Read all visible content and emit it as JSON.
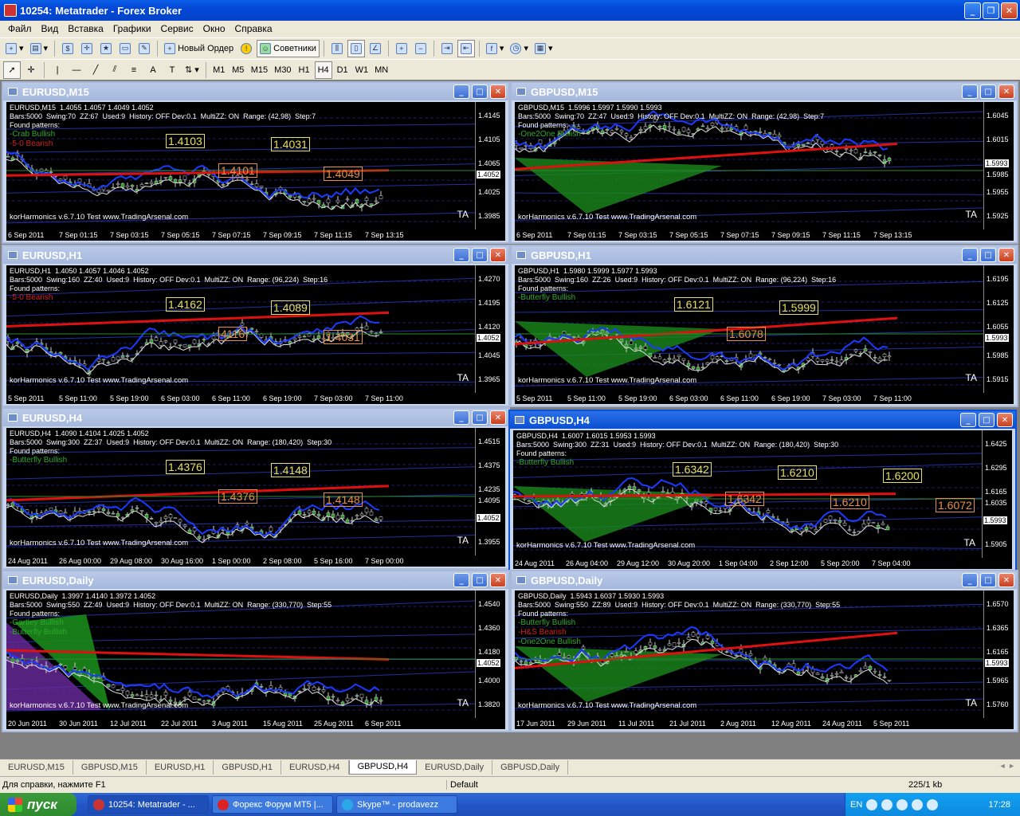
{
  "window": {
    "title": "10254: Metatrader - Forex Broker"
  },
  "menu": [
    "Файл",
    "Вид",
    "Вставка",
    "Графики",
    "Сервис",
    "Окно",
    "Справка"
  ],
  "toolbar": {
    "new_order": "Новый Ордер",
    "experts": "Советники"
  },
  "timeframes": [
    "M1",
    "M5",
    "M15",
    "M30",
    "H1",
    "H4",
    "D1",
    "W1",
    "MN"
  ],
  "active_timeframe": "H4",
  "charts": [
    {
      "id": "eurusd-m15",
      "title": "EURUSD,M15",
      "info": "EURUSD,M15  1.4055 1.4057 1.4049 1.4052\nBars:5000  Swing:70  ZZ:67  Used:9  History: OFF Dev:0.1  MultiZZ: ON  Range: (42,98)  Step:7\nFound patterns:",
      "patterns": [
        {
          "t": "-Crab Bullish",
          "c": "#2ea82e"
        },
        {
          "t": "-5-0 Bearish",
          "c": "#d02020"
        }
      ],
      "kor": "korHarmonics v.6.7.10 Test www.TradingArsenal.com",
      "prices": [
        "1.4145",
        "1.4105",
        "1.4065",
        "1.4052",
        "1.4025",
        "1.3985"
      ],
      "current": "1.4052",
      "times": [
        "6 Sep 2011",
        "7 Sep 01:15",
        "7 Sep 03:15",
        "7 Sep 05:15",
        "7 Sep 07:15",
        "7 Sep 09:15",
        "7 Sep 11:15",
        "7 Sep 13:15"
      ],
      "labels": [
        "1.4103",
        "1.4101",
        "1.4031",
        "1.4049"
      ]
    },
    {
      "id": "gbpusd-m15",
      "title": "GBPUSD,M15",
      "info": "GBPUSD,M15  1.5996 1.5997 1.5990 1.5993\nBars:5000  Swing:70  ZZ:47  Used:9  History: OFF Dev:0.1  MultiZZ: ON  Range: (42,98)  Step:7\nFound patterns:",
      "patterns": [
        {
          "t": "-One2One Bullish",
          "c": "#2ea82e"
        }
      ],
      "kor": "korHarmonics v.6.7.10 Test www.TradingArsenal.com",
      "prices": [
        "1.6045",
        "1.6015",
        "1.5993",
        "1.5985",
        "1.5955",
        "1.5925"
      ],
      "current": "1.5993",
      "times": [
        "6 Sep 2011",
        "7 Sep 01:15",
        "7 Sep 03:15",
        "7 Sep 05:15",
        "7 Sep 07:15",
        "7 Sep 09:15",
        "7 Sep 11:15",
        "7 Sep 13:15"
      ],
      "labels": []
    },
    {
      "id": "eurusd-h1",
      "title": "EURUSD,H1",
      "info": "EURUSD,H1  1.4050 1.4057 1.4046 1.4052\nBars:5000  Swing:160  ZZ:40  Used:9  History: OFF Dev:0.1  MultiZZ: ON  Range: (96,224)  Step:16\nFound patterns:",
      "patterns": [
        {
          "t": "-5-0 Bearish",
          "c": "#d02020"
        }
      ],
      "kor": "korHarmonics v.6.7.10 Test www.TradingArsenal.com",
      "prices": [
        "1.4270",
        "1.4195",
        "1.4120",
        "1.4052",
        "1.4045",
        "1.3965"
      ],
      "current": "1.4052",
      "times": [
        "5 Sep 2011",
        "5 Sep 11:00",
        "5 Sep 19:00",
        "6 Sep 03:00",
        "6 Sep 11:00",
        "6 Sep 19:00",
        "7 Sep 03:00",
        "7 Sep 11:00"
      ],
      "labels": [
        "1.4162",
        "4116",
        "1.4089",
        "1.4031"
      ]
    },
    {
      "id": "gbpusd-h1",
      "title": "GBPUSD,H1",
      "info": "GBPUSD,H1  1.5980 1.5999 1.5977 1.5993\nBars:5000  Swing:160  ZZ:26  Used:9  History: OFF Dev:0.1  MultiZZ: ON  Range: (96,224)  Step:16\nFound patterns:",
      "patterns": [
        {
          "t": "-Butterfly Bullish",
          "c": "#2ea82e"
        }
      ],
      "kor": "korHarmonics v.6.7.10 Test www.TradingArsenal.com",
      "prices": [
        "1.6195",
        "1.6125",
        "1.6055",
        "1.5993",
        "1.5985",
        "1.5915"
      ],
      "current": "1.5993",
      "times": [
        "5 Sep 2011",
        "5 Sep 11:00",
        "5 Sep 19:00",
        "6 Sep 03:00",
        "6 Sep 11:00",
        "6 Sep 19:00",
        "7 Sep 03:00",
        "7 Sep 11:00"
      ],
      "labels": [
        "1.6121",
        "1.6078",
        "1.5999"
      ]
    },
    {
      "id": "eurusd-h4",
      "title": "EURUSD,H4",
      "info": "EURUSD,H4  1.4090 1.4104 1.4025 1.4052\nBars:5000  Swing:300  ZZ:37  Used:9  History: OFF Dev:0.1  MultiZZ: ON  Range: (180,420)  Step:30\nFound patterns:",
      "patterns": [
        {
          "t": "-Butterfly Bullish",
          "c": "#2ea82e"
        }
      ],
      "kor": "korHarmonics v.6.7.10 Test www.TradingArsenal.com",
      "prices": [
        "1.4515",
        "1.4375",
        "1.4235",
        "1.4095",
        "1.4052",
        "1.3955"
      ],
      "current": "1.4052",
      "times": [
        "24 Aug 2011",
        "26 Aug 00:00",
        "29 Aug 08:00",
        "30 Aug 16:00",
        "1 Sep 00:00",
        "2 Sep 08:00",
        "5 Sep 16:00",
        "7 Sep 00:00"
      ],
      "labels": [
        "1.4376",
        "1.4376",
        "1.4148",
        "1.4148"
      ]
    },
    {
      "id": "gbpusd-h4",
      "title": "GBPUSD,H4",
      "info": "GBPUSD,H4  1.6007 1.6015 1.5953 1.5993\nBars:5000  Swing:300  ZZ:31  Used:9  History: OFF Dev:0.1  MultiZZ: ON  Range: (180,420)  Step:30\nFound patterns:",
      "patterns": [
        {
          "t": "-Butterfly Bullish",
          "c": "#2ea82e"
        }
      ],
      "kor": "korHarmonics v.6.7.10 Test www.TradingArsenal.com",
      "prices": [
        "1.6425",
        "1.6295",
        "1.6165",
        "1.6035",
        "1.5993",
        "1.5905"
      ],
      "current": "1.5993",
      "times": [
        "24 Aug 2011",
        "26 Aug 04:00",
        "29 Aug 12:00",
        "30 Aug 20:00",
        "1 Sep 04:00",
        "2 Sep 12:00",
        "5 Sep 20:00",
        "7 Sep 04:00"
      ],
      "labels": [
        "1.6342",
        "1.6342",
        "1.6210",
        "1.6210",
        "1.6200",
        "1.6072"
      ]
    },
    {
      "id": "eurusd-daily",
      "title": "EURUSD,Daily",
      "info": "EURUSD,Daily  1.3997 1.4140 1.3972 1.4052\nBars:5000  Swing:550  ZZ:49  Used:9  History: OFF Dev:0.1  MultiZZ: ON  Range: (330,770)  Step:55\nFound patterns:",
      "patterns": [
        {
          "t": "-Gartley Bullish",
          "c": "#2ea82e"
        },
        {
          "t": "-Butterfly Bullish",
          "c": "#2ea82e"
        }
      ],
      "kor": "korHarmonics v.6.7.10 Test www.TradingArsenal.com",
      "prices": [
        "1.4540",
        "1.4360",
        "1.4180",
        "1.4052",
        "1.4000",
        "1.3820"
      ],
      "current": "1.4052",
      "times": [
        "20 Jun 2011",
        "30 Jun 2011",
        "12 Jul 2011",
        "22 Jul 2011",
        "3 Aug 2011",
        "15 Aug 2011",
        "25 Aug 2011",
        "6 Sep 2011"
      ],
      "labels": []
    },
    {
      "id": "gbpusd-daily",
      "title": "GBPUSD,Daily",
      "info": "GBPUSD,Daily  1.5943 1.6037 1.5930 1.5993\nBars:5000  Swing:550  ZZ:89  Used:9  History: OFF Dev:0.1  MultiZZ: ON  Range: (330,770)  Step:55\nFound patterns:",
      "patterns": [
        {
          "t": "-Butterfly Bullish",
          "c": "#2ea82e"
        },
        {
          "t": "-H&S Bearish",
          "c": "#d02020"
        },
        {
          "t": "-One2One Bullish",
          "c": "#2ea82e"
        }
      ],
      "kor": "korHarmonics v.6.7.10 Test www.TradingArsenal.com",
      "prices": [
        "1.6570",
        "1.6365",
        "1.6165",
        "1.5993",
        "1.5965",
        "1.5760"
      ],
      "current": "1.5993",
      "times": [
        "17 Jun 2011",
        "29 Jun 2011",
        "11 Jul 2011",
        "21 Jul 2011",
        "2 Aug 2011",
        "12 Aug 2011",
        "24 Aug 2011",
        "5 Sep 2011"
      ],
      "labels": []
    }
  ],
  "tabs": [
    "EURUSD,M15",
    "GBPUSD,M15",
    "EURUSD,H1",
    "GBPUSD,H1",
    "EURUSD,H4",
    "GBPUSD,H4",
    "EURUSD,Daily",
    "GBPUSD,Daily"
  ],
  "active_tab": "GBPUSD,H4",
  "status": {
    "help": "Для справки, нажмите F1",
    "profile": "Default",
    "traffic": "225/1 kb"
  },
  "taskbar": {
    "start": "пуск",
    "tasks": [
      "10254: Metatrader - ...",
      "Форекс Форум MT5 |...",
      "Skype™ - prodavezz"
    ],
    "lang": "EN",
    "clock": "17:28"
  }
}
